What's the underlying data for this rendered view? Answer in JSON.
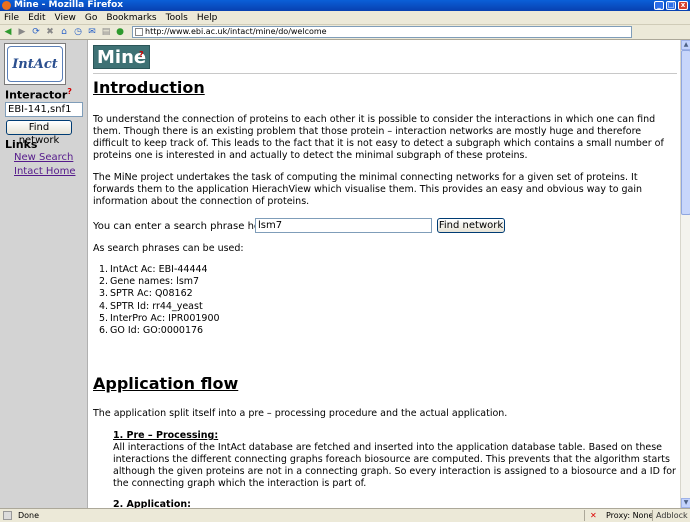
{
  "window": {
    "title": "Mine - Mozilla Firefox",
    "controls": {
      "minimize": "_",
      "maximize": "□",
      "close": "x"
    }
  },
  "menu": {
    "items": [
      "File",
      "Edit",
      "View",
      "Go",
      "Bookmarks",
      "Tools",
      "Help"
    ]
  },
  "navigation": {
    "url": "http://www.ebi.ac.uk/intact/mine/do/welcome",
    "icons": [
      "back-icon",
      "forward-icon",
      "reload-icon",
      "stop-icon",
      "home-icon",
      "history-icon",
      "mail-icon",
      "print-icon",
      "search-icon",
      "lock-icon"
    ]
  },
  "sidebar": {
    "logo_text": "IntAct",
    "interactor_heading": "Interactor",
    "help_mark": "?",
    "interactor_value": "EBI-141,snf1",
    "find_button": "Find network",
    "links_heading": "Links",
    "links": [
      "New Search",
      "Intact Home"
    ]
  },
  "main": {
    "logo": "Mine",
    "logo_help": "?",
    "intro_heading": "Introduction",
    "intro_para1": "To understand the connection of proteins to each other it is possible to consider the interactions in which one can find them. Though there is an existing problem that those protein – interaction networks are mostly huge and therefore difficult to keep track of. This leads to the fact that it is not easy to detect a subgraph which contains a small number of proteins one is interested in and actually to detect the minimal subgraph of these proteins.",
    "intro_para2": "The MiNe project undertakes the task of computing the minimal connecting networks for a given set of proteins. It forwards them to the application HierachView which visualise them. This provides an easy and obvious way to gain information about the connection of proteins.",
    "search_label": "You can enter a search phrase here:",
    "search_value": "lsm7",
    "search_button": "Find network",
    "phrases_intro": "As search phrases can be used:",
    "phrases": [
      "IntAct Ac: EBI-44444",
      "Gene names: lsm7",
      "SPTR Ac: Q08162",
      "SPTR Id: rr44_yeast",
      "InterPro Ac: IPR001900",
      "GO Id: GO:0000176"
    ],
    "flow_heading": "Application flow",
    "flow_para": "The application split itself into a pre – processing procedure and the actual application.",
    "step1_heading": "1. Pre – Processing:",
    "step1_text": "All interactions of the IntAct database are fetched and inserted into the application database table. Based on these interactions the different connecting graphs foreach biosource are computed. This prevents that the algorithm starts although the given proteins are not in a connecting graph. So every interaction is assigned to a biosource and a ID for the connecting graph which the interaction is part of.",
    "step2_heading": "2. Application:"
  },
  "status": {
    "text": "Done",
    "proxy": "Proxy: None",
    "adblock": "Adblock"
  }
}
